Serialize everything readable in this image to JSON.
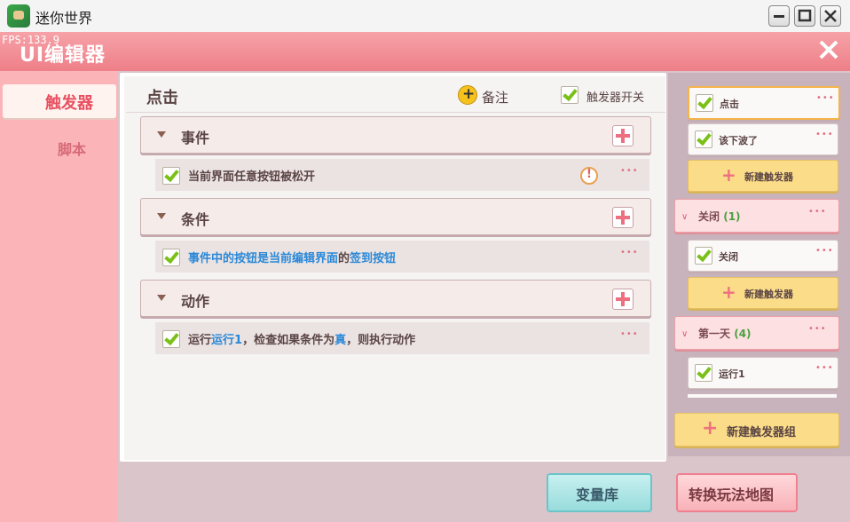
{
  "window": {
    "title": "迷你世界"
  },
  "header": {
    "title": "UI编辑器",
    "fps": "FPS:133.9"
  },
  "sidebar": {
    "items": [
      {
        "label": "触发器"
      },
      {
        "label": "脚本"
      }
    ]
  },
  "trigger": {
    "name": "点击",
    "note_label": "备注",
    "switch_label": "触发器开关",
    "sections": [
      {
        "label": "事件",
        "row": "当前界面任意按钮被松开"
      },
      {
        "label": "条件",
        "row": {
          "p1": "事件中的按钮是当前编辑界面",
          "p2": "的",
          "p3": "签到按钮"
        }
      },
      {
        "label": "动作",
        "row": {
          "p1": "运行",
          "p2": "运行1",
          "p3": "，检查如果条件为",
          "p4": "真",
          "p5": "，则执行动作"
        }
      }
    ]
  },
  "right_panel": {
    "cards": [
      "点击",
      "该下波了"
    ],
    "new_trigger_label": "新建触发器",
    "groups": [
      {
        "name": "关闭",
        "count": "(1)",
        "cards": [
          "关闭"
        ]
      },
      {
        "name": "第一天",
        "count": "(4)",
        "cards": [
          "运行1"
        ]
      }
    ],
    "new_group_label": "新建触发器组"
  },
  "footer": {
    "variables_button": "变量库",
    "convert_button": "转换玩法地图"
  },
  "colors": {
    "header": "#ee7f88",
    "accent_green": "#7ac018",
    "new_trigger": "#fbdc88"
  }
}
